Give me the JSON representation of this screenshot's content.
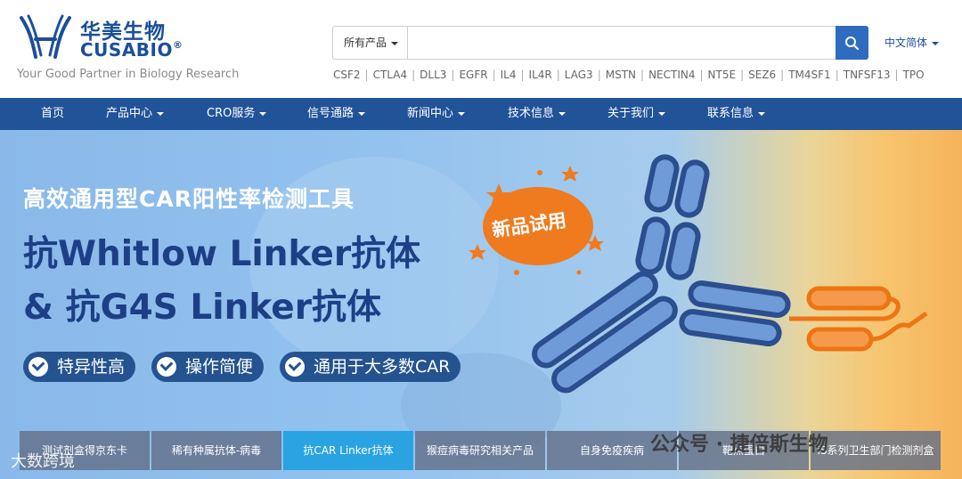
{
  "brand": {
    "name_cn": "华美生物",
    "name_en": "CUSABIO",
    "reg": "®",
    "tagline": "Your Good Partner in Biology Research"
  },
  "search": {
    "category": "所有产品",
    "value": "",
    "placeholder": ""
  },
  "language": "中文简体",
  "hot_tags": [
    "CSF2",
    "CTLA4",
    "DLL3",
    "EGFR",
    "IL4",
    "IL4R",
    "LAG3",
    "MSTN",
    "NECTIN4",
    "NT5E",
    "SEZ6",
    "TM4SF1",
    "TNFSF13",
    "TPO"
  ],
  "nav": {
    "items": [
      {
        "label": "首页"
      },
      {
        "label": "产品中心"
      },
      {
        "label": "CRO服务"
      },
      {
        "label": "信号通路"
      },
      {
        "label": "新闻中心"
      },
      {
        "label": "技术信息"
      },
      {
        "label": "关于我们"
      },
      {
        "label": "联系信息"
      }
    ]
  },
  "banner": {
    "subtitle": "高效通用型CAR阳性率检测工具",
    "title_line1": "抗Whitlow Linker抗体",
    "title_line2": "& 抗G4S Linker抗体",
    "badge": "新品试用",
    "features": [
      "特异性高",
      "操作简便",
      "通用于大多数CAR"
    ]
  },
  "tabs": [
    {
      "label": "测试剂盒得京东卡"
    },
    {
      "label": "稀有种属抗体-病毒"
    },
    {
      "label": "抗CAR Linker抗体"
    },
    {
      "label": "猴痘病毒研究相关产品"
    },
    {
      "label": "自身免疫疾病"
    },
    {
      "label": "靶点蛋白"
    },
    {
      "label": "iS系列卫生部门检测剂盒"
    }
  ],
  "watermarks": {
    "left": "大数跨境",
    "right": "公众号 · 捷倍斯生物"
  },
  "colors": {
    "brand_blue": "#1b4f9a",
    "nav_bg": "#215398",
    "search_btn": "#2f6cc0",
    "badge_orange": "#f07a1e",
    "active_tab": "#2aa3e3"
  }
}
